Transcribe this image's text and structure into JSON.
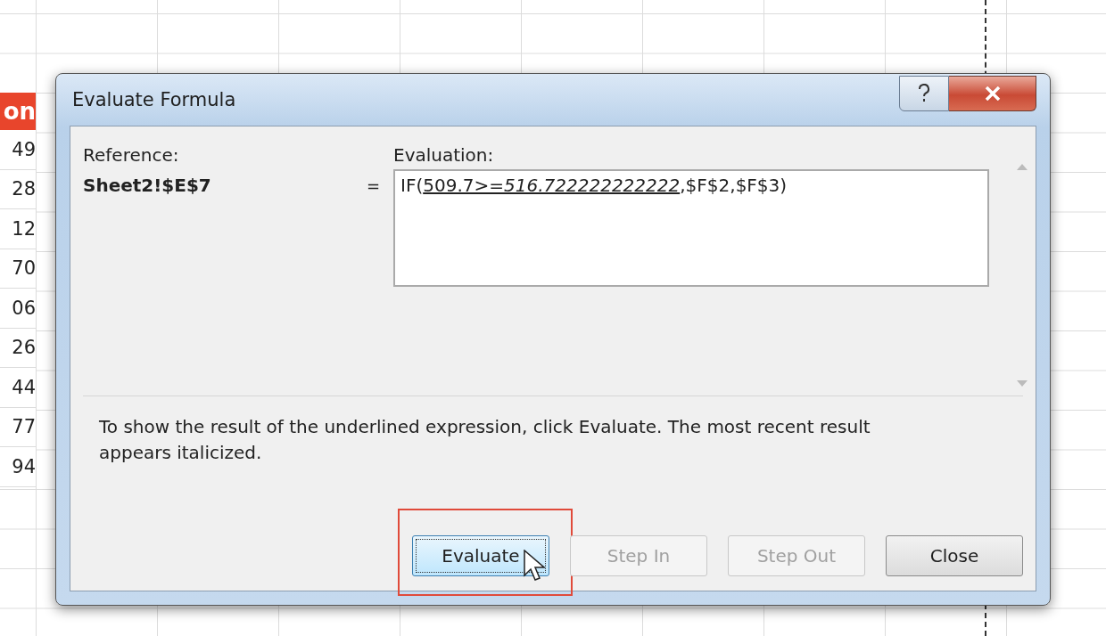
{
  "sheet": {
    "header": "on",
    "cells": [
      "49",
      "28",
      "12",
      "70",
      "06",
      "26",
      "44",
      "77",
      "94"
    ]
  },
  "window": {
    "title": "Evaluate Formula"
  },
  "reference": {
    "label": "Reference:",
    "value": "Sheet2!$E$7",
    "equals": "="
  },
  "evaluation": {
    "label": "Evaluation:",
    "before": "IF(",
    "underlined": "509.7>=*516.722222222222*",
    "after": ",$F$2,$F$3)"
  },
  "message": "To show the result of the underlined expression, click Evaluate.  The most recent result appears italicized.",
  "buttons": [
    {
      "label": "Evaluate",
      "disabled": false,
      "focused": true
    },
    {
      "label": "Step In",
      "disabled": true,
      "focused": false
    },
    {
      "label": "Step Out",
      "disabled": true,
      "focused": false
    },
    {
      "label": "Close",
      "disabled": false,
      "focused": false
    }
  ]
}
